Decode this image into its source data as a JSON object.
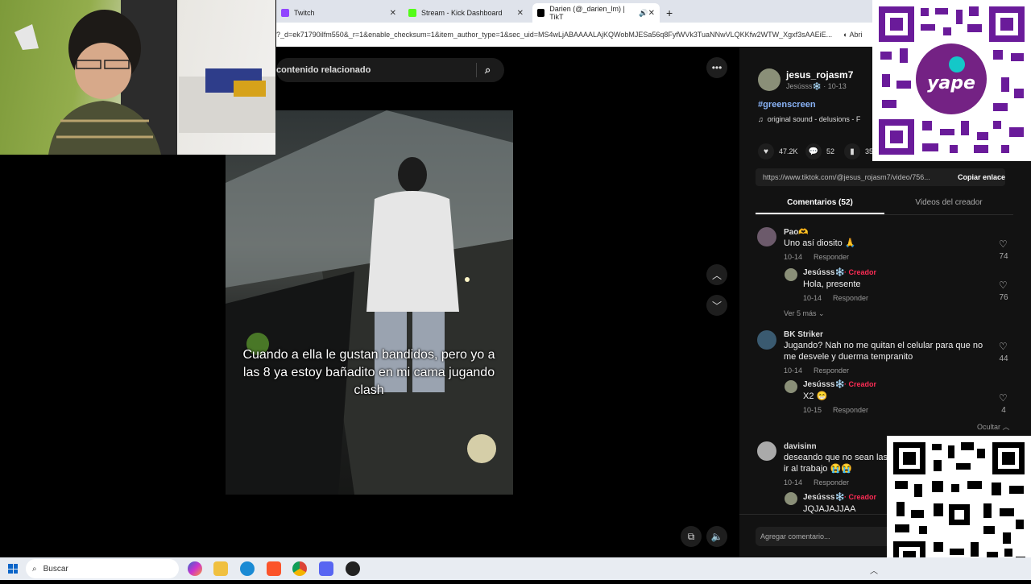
{
  "tabs": [
    {
      "label": "Twitch",
      "color": "#9146ff"
    },
    {
      "label": "Stream - Kick Dashboard",
      "color": "#53fc18"
    },
    {
      "label": "Darien (@_darien_lm) | TikT",
      "color": "#000000"
    }
  ],
  "address": {
    "url": "?_d=ek71790ilfm550&_r=1&enable_checksum=1&item_author_type=1&sec_uid=MS4wLjABAAAALAjKQWobMJESa56q8FyfWVk3TuaNNwVLQKKfw2WTW_Xgxf3sAAEiE...",
    "extra": "Abri"
  },
  "search": {
    "text": "contenido relacionado"
  },
  "video": {
    "caption": "Cuando a ella le gustan bandidos, pero yo a las 8 ya estoy bañadito en mi cama jugando clash"
  },
  "author": {
    "username": "jesus_rojasm7",
    "display": "Jesússs❄️ · 10-13",
    "hashtag": "#greenscreen",
    "sound": "original sound - delusions - F"
  },
  "stats": {
    "likes": "47.2K",
    "comments": "52",
    "saves": "35"
  },
  "link": {
    "url": "https://www.tiktok.com/@jesus_rojasm7/video/756...",
    "copy": "Copiar enlace"
  },
  "panel_tabs": {
    "comments": "Comentarios (52)",
    "videos": "Videos del creador"
  },
  "comments": [
    {
      "user": "Pao🫶",
      "text": "Uno así diosito 🙏",
      "date": "10-14",
      "reply": "Responder",
      "likes": "74",
      "reply_item": {
        "user": "Jesússs❄️",
        "creator": "· Creador",
        "text": "Hola, presente",
        "date": "10-14",
        "reply": "Responder",
        "likes": "76"
      },
      "more": "Ver 5 más"
    },
    {
      "user": "BK Striker",
      "text": "Jugando? Nah no me quitan el celular para que no me desvele y duerma tempranito",
      "date": "10-14",
      "reply": "Responder",
      "likes": "44",
      "reply_item": {
        "user": "Jesússs❄️",
        "creator": "· Creador",
        "text": "X2 😁",
        "date": "10-15",
        "reply": "Responder",
        "likes": "4"
      },
      "more": "Ocultar"
    },
    {
      "user": "davisinn",
      "text": "deseando que no sean las ir al trabajo 😭😭",
      "date": "10-14",
      "reply": "Responder",
      "likes": "",
      "reply_item": {
        "user": "Jesússs❄️",
        "creator": "· Creador",
        "text": "JQJAJAJJAA",
        "date": "",
        "reply": "",
        "likes": ""
      },
      "more": ""
    }
  ],
  "add_comment": "Agregar comentario...",
  "qr_logo": "yape",
  "taskbar": {
    "search": "Buscar"
  }
}
